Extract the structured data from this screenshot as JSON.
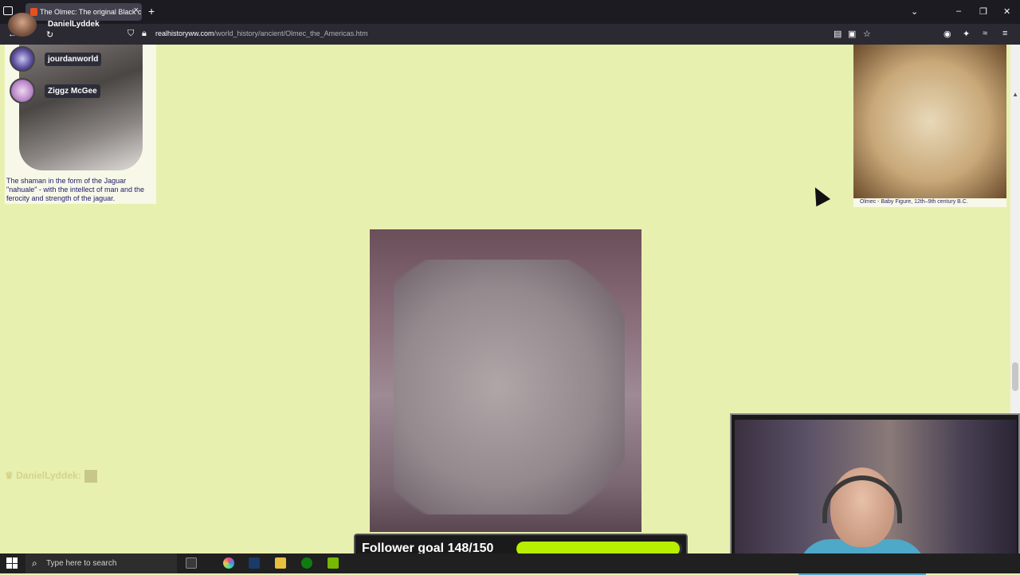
{
  "browser": {
    "tab_title": "The Olmec: The original Black c",
    "url_domain": "realhistoryww.com",
    "url_path": "/world_history/ancient/Olmec_the_Americas.htm"
  },
  "stream": {
    "streamer_name": "DanielLyddek",
    "follower_goal_label": "Follower goal 148/150",
    "follower_goal_progress": 0.987
  },
  "chat": {
    "users": [
      {
        "name": "jourdanworld"
      },
      {
        "name": "Ziggz McGee"
      }
    ],
    "faded_line": "DanielLyddek:"
  },
  "page": {
    "left_caption": "The shaman in the form of the Jaguar \"nahuale\" - with the intellect of man and the ferocity and strength of the jaguar.",
    "right_caption": "Olmec - Baby Figure, 12th–9th century B.C."
  },
  "taskbar": {
    "search_placeholder": "Type here to search"
  },
  "colors": {
    "page_bg": "#e8f0b0",
    "goal_fill": "#b8ee00",
    "chrome_dark": "#1c1b22"
  }
}
